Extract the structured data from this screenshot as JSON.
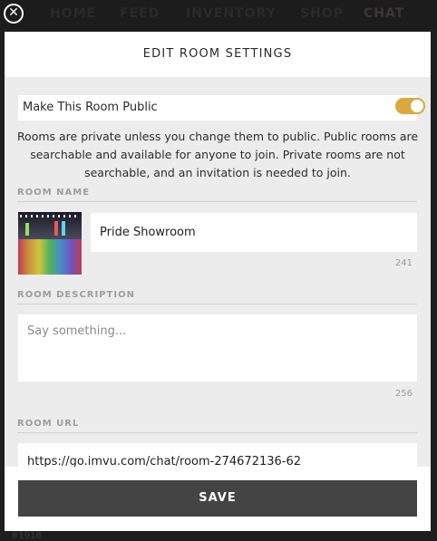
{
  "nav": {
    "items": [
      "HOME",
      "FEED",
      "INVENTORY",
      "SHOP",
      "CHAT"
    ],
    "close_icon": "close-circle-icon"
  },
  "background": {
    "bottom_text": "#1916"
  },
  "modal": {
    "title": "EDIT ROOM SETTINGS",
    "public_toggle": {
      "label": "Make This Room Public",
      "on": true,
      "color": "#d9a93d"
    },
    "info_text": "Rooms are private unless you change them to public. Public rooms are searchable and available for anyone to join. Private rooms are not searchable, and an invitation is needed to join.",
    "room_name": {
      "section_label": "ROOM NAME",
      "value": "Pride Showroom",
      "counter": "241"
    },
    "room_description": {
      "section_label": "ROOM DESCRIPTION",
      "placeholder": "Say something...",
      "counter": "256"
    },
    "room_url": {
      "section_label": "ROOM URL",
      "value": "https://go.imvu.com/chat/room-274672136-62"
    },
    "save_label": "SAVE"
  }
}
